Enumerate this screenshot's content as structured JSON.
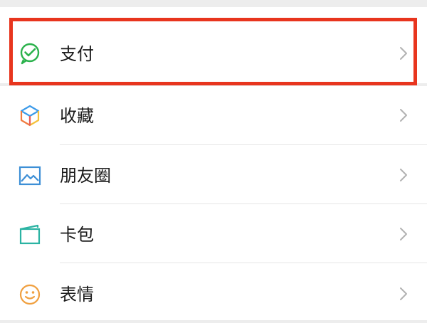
{
  "menu": {
    "pay": {
      "label": "支付",
      "icon": "wechat-pay-icon"
    },
    "items": [
      {
        "label": "收藏",
        "icon": "cube-icon"
      },
      {
        "label": "朋友圈",
        "icon": "image-icon"
      },
      {
        "label": "卡包",
        "icon": "card-icon"
      },
      {
        "label": "表情",
        "icon": "smiley-icon"
      }
    ]
  },
  "highlight_color": "#e8351e"
}
